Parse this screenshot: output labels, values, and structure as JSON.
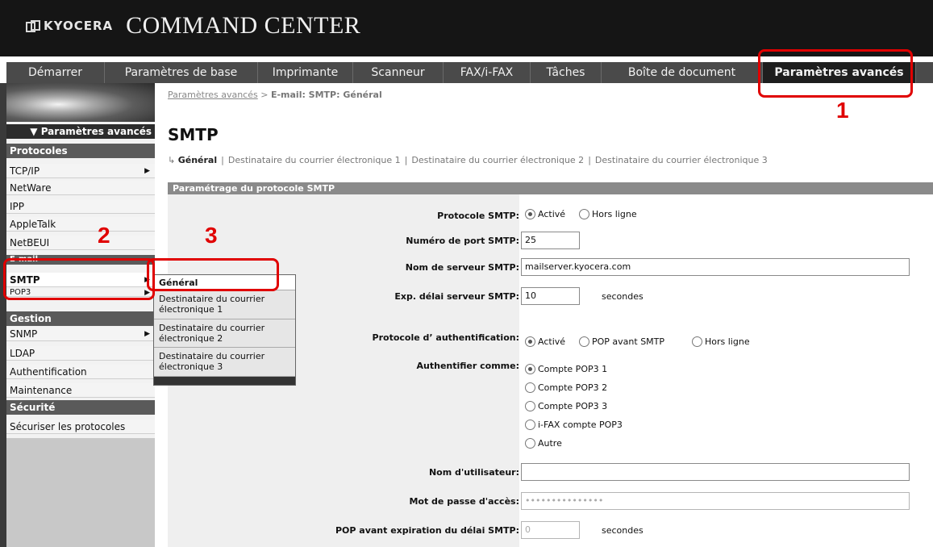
{
  "header": {
    "brand": "KYOCERA",
    "product_title": "COMMAND CENTER"
  },
  "nav": {
    "tabs": [
      {
        "label": "Démarrer"
      },
      {
        "label": "Paramètres de base"
      },
      {
        "label": "Imprimante"
      },
      {
        "label": "Scanneur"
      },
      {
        "label": "FAX/i-FAX"
      },
      {
        "label": "Tâches"
      },
      {
        "label": "Boîte de document"
      },
      {
        "label": "Paramètres avancés",
        "active": true
      }
    ]
  },
  "sidebar": {
    "header": "▼ Paramètres avancés",
    "sections": {
      "protocoles": "Protocoles",
      "email": "E-mail",
      "gestion": "Gestion",
      "securite": "Sécurité"
    },
    "items": {
      "tcpip": "TCP/IP",
      "netware": "NetWare",
      "ipp": "IPP",
      "appletalk": "AppleTalk",
      "netbeui": "NetBEUI",
      "smtp": "SMTP",
      "pop3": "POP3",
      "snmp": "SNMP",
      "ldap": "LDAP",
      "authentification": "Authentification",
      "maintenance": "Maintenance",
      "securiser": "Sécuriser les protocoles"
    }
  },
  "popup": {
    "items": [
      {
        "label": "Général",
        "selected": true
      },
      {
        "label": "Destinataire du courrier électronique 1"
      },
      {
        "label": "Destinataire du courrier électronique 2"
      },
      {
        "label": "Destinataire du courrier électronique 3"
      }
    ]
  },
  "breadcrumb": {
    "link": "Paramètres avancés",
    "separator": " > ",
    "current": "E-mail: SMTP: Général"
  },
  "page_title": "SMTP",
  "subnav": {
    "active": "Général",
    "links": [
      "Destinataire du courrier électronique 1",
      "Destinataire du courrier électronique 2",
      "Destinataire du courrier électronique 3"
    ]
  },
  "section_bar": "Paramétrage du protocole SMTP",
  "form": {
    "protocole_smtp": {
      "label": "Protocole SMTP:",
      "options": [
        "Activé",
        "Hors ligne"
      ],
      "selected": "Activé"
    },
    "port": {
      "label": "Numéro de port SMTP:",
      "value": "25"
    },
    "serveur": {
      "label": "Nom de serveur SMTP:",
      "value": "mailserver.kyocera.com"
    },
    "delai": {
      "label": "Exp. délai serveur SMTP:",
      "value": "10",
      "unit": "secondes"
    },
    "auth_protocole": {
      "label": "Protocole d’ authentification:",
      "options": [
        "Activé",
        "POP avant SMTP",
        "Hors ligne"
      ],
      "selected": "Activé"
    },
    "auth_comme": {
      "label": "Authentifier comme:",
      "options": [
        "Compte POP3 1",
        "Compte POP3 2",
        "Compte POP3 3",
        "i-FAX compte POP3",
        "Autre"
      ],
      "selected": "Compte POP3 1"
    },
    "utilisateur": {
      "label": "Nom d'utilisateur:",
      "value": ""
    },
    "mot_de_passe": {
      "label": "Mot de passe d'accès:",
      "value": "•••••••••••••••"
    },
    "pop_delai": {
      "label": "POP avant expiration du délai SMTP:",
      "value": "0",
      "unit": "secondes"
    }
  },
  "annotations": [
    "1",
    "2",
    "3"
  ],
  "colors": {
    "callout": "#e00000",
    "header_bg": "#151515",
    "nav_bg": "#4a4a4a",
    "section_bar": "#8a8a8a"
  }
}
